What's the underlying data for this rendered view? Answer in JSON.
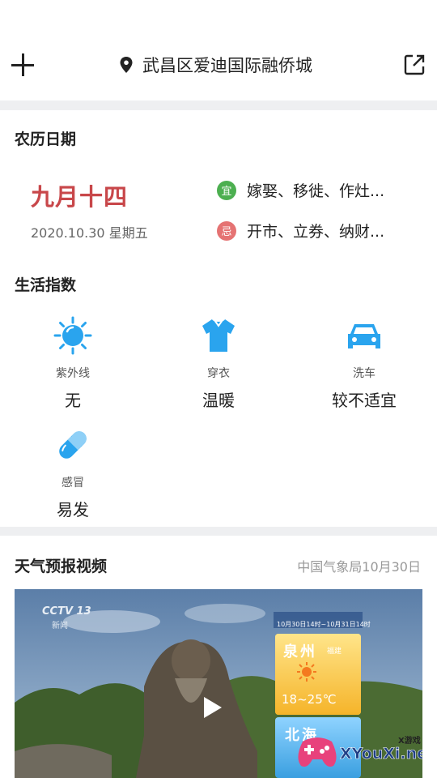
{
  "header": {
    "location": "武昌区爱迪国际融侨城"
  },
  "lunar": {
    "title": "农历日期",
    "lunar_date": "九月十四",
    "gregorian_date": "2020.10.30 星期五",
    "yi_badge": "宜",
    "yi_text": "嫁娶、移徙、作灶...",
    "ji_badge": "忌",
    "ji_text": "开市、立券、纳财...",
    "yi_color": "#4caf50",
    "ji_color": "#e57373"
  },
  "life": {
    "title": "生活指数",
    "items": [
      {
        "label": "紫外线",
        "value": "无",
        "icon": "sun-icon"
      },
      {
        "label": "穿衣",
        "value": "温暖",
        "icon": "shirt-icon"
      },
      {
        "label": "洗车",
        "value": "较不适宜",
        "icon": "car-icon"
      },
      {
        "label": "感冒",
        "value": "易发",
        "icon": "pill-icon"
      }
    ]
  },
  "video": {
    "title": "天气预报视频",
    "source": "中国气象局10月30日",
    "channel_logo": "CCTV 13",
    "channel_sub": "新闻",
    "card_date": "10月30日14时~10月31日14时",
    "city1": "泉州",
    "city1_sub": "福建",
    "temp1": "18~25℃",
    "city2": "北海",
    "watermark_top": "X游戏",
    "watermark": "XYouXi.net"
  }
}
